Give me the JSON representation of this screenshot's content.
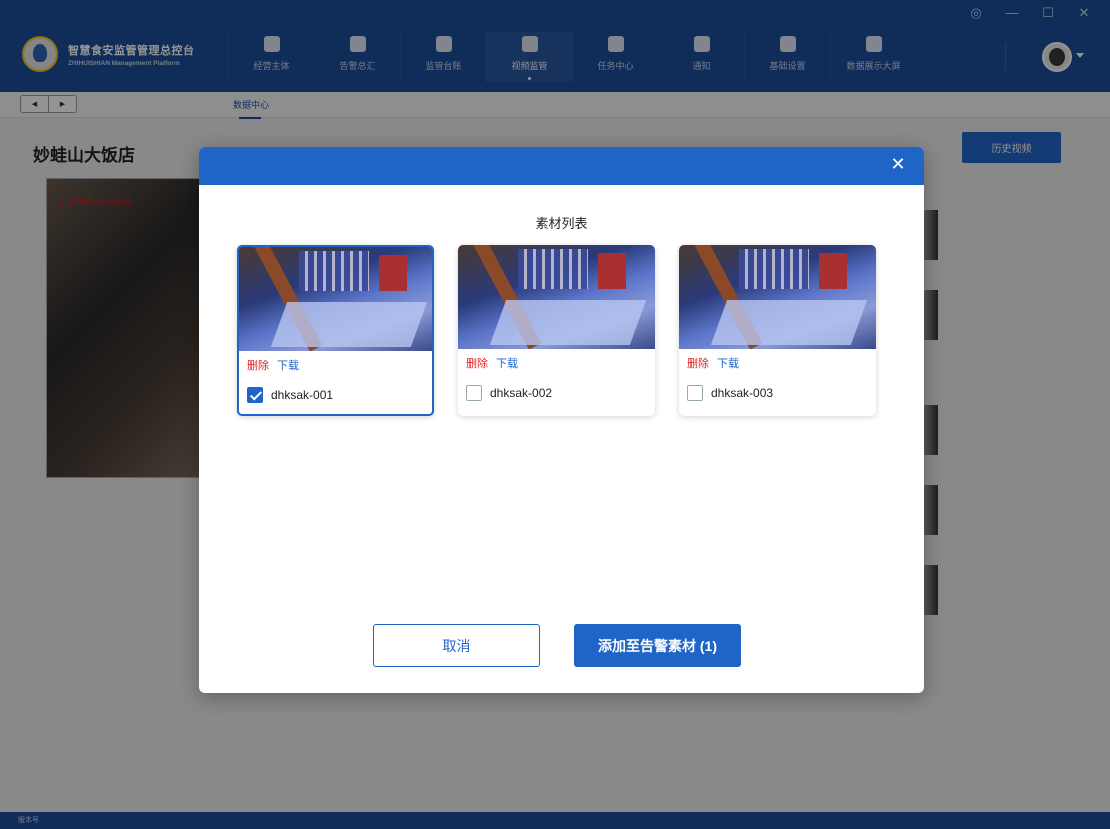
{
  "app": {
    "title": "智慧食安监管管理总控台",
    "subtitle": "ZHIHUISHIAN Management Platform",
    "window_controls": [
      "◎",
      "—",
      "☐",
      "✕"
    ]
  },
  "nav": [
    {
      "label": "经营主体",
      "icon": "building-icon"
    },
    {
      "label": "告警总汇",
      "icon": "alarm-icon"
    },
    {
      "label": "监管台账",
      "icon": "ledger-icon"
    },
    {
      "label": "视频监管",
      "icon": "camera-icon",
      "active": true
    },
    {
      "label": "任务中心",
      "icon": "clipboard-icon"
    },
    {
      "label": "通知",
      "icon": "chat-icon"
    },
    {
      "label": "基础设置",
      "icon": "gear-icon"
    },
    {
      "label": "数据展示大屏",
      "icon": "screen-icon"
    }
  ],
  "subbar": {
    "prev": "◀",
    "next": "▶",
    "tab": "数据中心"
  },
  "page": {
    "store_title": "妙蛙山大饭店",
    "history_button": "历史视频",
    "recording_label": "录制中 00:10:00"
  },
  "footer": {
    "version_label": "版本号"
  },
  "modal": {
    "close": "✕",
    "title": "素材列表",
    "cards": [
      {
        "name": "dhksak-001",
        "delete": "删除",
        "download": "下载",
        "checked": true
      },
      {
        "name": "dhksak-002",
        "delete": "删除",
        "download": "下载",
        "checked": false
      },
      {
        "name": "dhksak-003",
        "delete": "删除",
        "download": "下载",
        "checked": false
      }
    ],
    "cancel": "取消",
    "confirm": "添加至告警素材 (1)"
  },
  "colors": {
    "header": "#1c4f9c",
    "primary": "#1f64c7",
    "danger": "#e02020"
  }
}
